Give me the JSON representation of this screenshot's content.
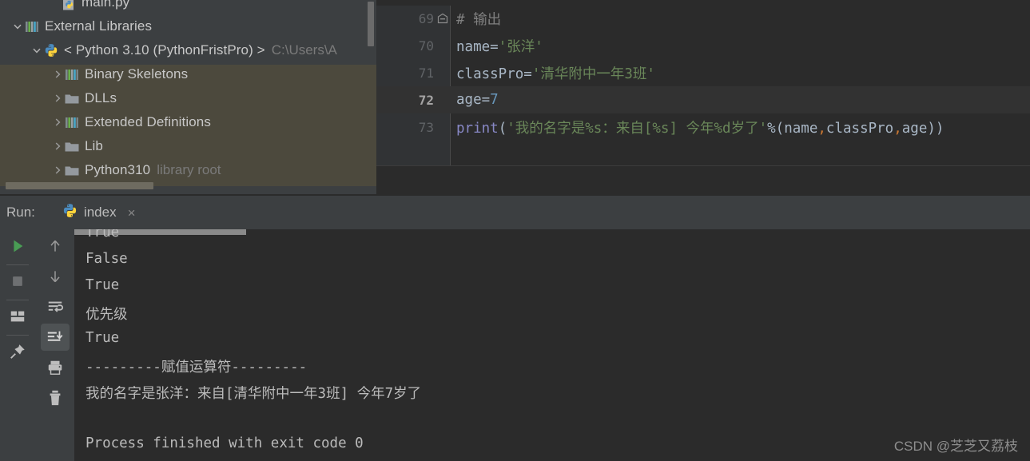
{
  "project_tree": {
    "items": [
      {
        "label": "main.py",
        "icon": "python-file-icon",
        "arrow": "none",
        "indent": 60,
        "sub": ""
      },
      {
        "label": "External Libraries",
        "icon": "library-bars-icon",
        "arrow": "down",
        "indent": 14,
        "sub": ""
      },
      {
        "label": "< Python 3.10 (PythonFristPro) >",
        "icon": "python-icon",
        "arrow": "down",
        "indent": 38,
        "sub": "C:\\Users\\A"
      },
      {
        "label": "Binary Skeletons",
        "icon": "library-bars-icon",
        "arrow": "right",
        "indent": 64,
        "sub": ""
      },
      {
        "label": "DLLs",
        "icon": "folder-icon",
        "arrow": "right",
        "indent": 64,
        "sub": ""
      },
      {
        "label": "Extended Definitions",
        "icon": "library-bars-icon",
        "arrow": "right",
        "indent": 64,
        "sub": ""
      },
      {
        "label": "Lib",
        "icon": "folder-icon",
        "arrow": "right",
        "indent": 64,
        "sub": ""
      },
      {
        "label": "Python310",
        "icon": "folder-icon",
        "arrow": "right",
        "indent": 64,
        "sub": "library root"
      }
    ]
  },
  "editor": {
    "lines": [
      {
        "number": "69",
        "current": false,
        "fold": true,
        "tokens": [
          {
            "text": "# 输出",
            "cls": "c-comment"
          }
        ]
      },
      {
        "number": "70",
        "current": false,
        "fold": false,
        "tokens": [
          {
            "text": "name=",
            "cls": "c-ident"
          },
          {
            "text": "'张洋'",
            "cls": "c-string"
          }
        ]
      },
      {
        "number": "71",
        "current": false,
        "fold": false,
        "tokens": [
          {
            "text": "classPro=",
            "cls": "c-ident"
          },
          {
            "text": "'清华附中一年3班'",
            "cls": "c-string"
          }
        ]
      },
      {
        "number": "72",
        "current": true,
        "fold": false,
        "tokens": [
          {
            "text": "age=",
            "cls": "c-ident"
          },
          {
            "text": "7",
            "cls": "c-number"
          }
        ]
      },
      {
        "number": "73",
        "current": false,
        "fold": false,
        "tokens": [
          {
            "text": "print",
            "cls": "c-func"
          },
          {
            "text": "(",
            "cls": "c-paren"
          },
          {
            "text": "'我的名字是%s：来自[%s] 今年%d岁了'",
            "cls": "c-string"
          },
          {
            "text": "%(",
            "cls": "c-paren"
          },
          {
            "text": "name",
            "cls": "c-ident"
          },
          {
            "text": ",",
            "cls": "c-comma"
          },
          {
            "text": "classPro",
            "cls": "c-ident"
          },
          {
            "text": ",",
            "cls": "c-comma"
          },
          {
            "text": "age",
            "cls": "c-ident"
          },
          {
            "text": "))",
            "cls": "c-paren"
          }
        ]
      }
    ]
  },
  "run_panel": {
    "label": "Run:",
    "tab": {
      "label": "index",
      "icon": "python-icon",
      "close": "×"
    },
    "toolbar_left": [
      {
        "name": "rerun-button",
        "icon": "play-icon"
      },
      {
        "name": "stop-button",
        "icon": "stop-icon"
      },
      {
        "name": "restore-layout-button",
        "icon": "layout-icon"
      },
      {
        "name": "pin-tab-button",
        "icon": "pin-icon"
      }
    ],
    "toolbar_right": [
      {
        "name": "prev-occurrence-button",
        "icon": "arrow-up-icon",
        "selected": false
      },
      {
        "name": "next-occurrence-button",
        "icon": "arrow-down-icon",
        "selected": false
      },
      {
        "name": "soft-wrap-button",
        "icon": "soft-wrap-icon",
        "selected": false
      },
      {
        "name": "scroll-to-end-button",
        "icon": "scroll-to-end-icon",
        "selected": true
      },
      {
        "name": "print-button",
        "icon": "printer-icon",
        "selected": false
      },
      {
        "name": "clear-all-button",
        "icon": "trash-icon",
        "selected": false
      }
    ],
    "console_lines": [
      "True",
      "False",
      "True",
      "优先级",
      "True",
      "---------赋值运算符---------",
      "我的名字是张洋：来自[清华附中一年3班] 今年7岁了",
      "",
      "Process finished with exit code 0"
    ]
  },
  "watermark": "CSDN @芝芝又荔枝",
  "colors": {
    "panel_bg": "#3c3f41",
    "editor_bg": "#2b2b2b",
    "gutter_bg": "#313335",
    "tree_selection_bg": "#4c493d",
    "text": "#bbbbbb",
    "accent_green": "#499c54",
    "string_green": "#6a8759",
    "number_blue": "#6897bb",
    "keyword_orange": "#cc7832"
  }
}
